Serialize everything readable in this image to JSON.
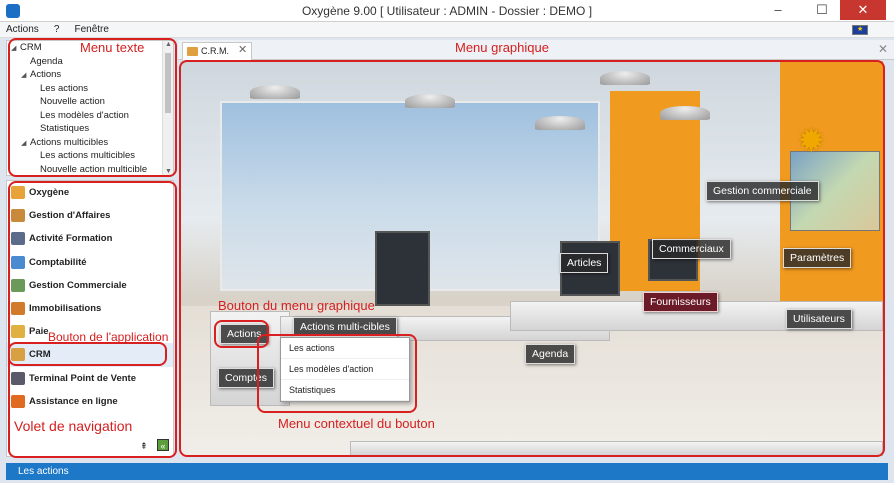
{
  "window": {
    "title": "Oxygène 9.00 [ Utilisateur : ADMIN - Dossier : DEMO ]",
    "minimize": "–",
    "maximize": "☐",
    "close": "✕"
  },
  "menubar": [
    "Actions",
    "?",
    "Fenêtre"
  ],
  "tree": {
    "items": [
      {
        "label": "CRM",
        "level": 0,
        "expander": "◢"
      },
      {
        "label": "Agenda",
        "level": 1,
        "expander": ""
      },
      {
        "label": "Actions",
        "level": 1,
        "expander": "◢"
      },
      {
        "label": "Les actions",
        "level": 2,
        "expander": ""
      },
      {
        "label": "Nouvelle action",
        "level": 2,
        "expander": ""
      },
      {
        "label": "Les modèles d'action",
        "level": 2,
        "expander": ""
      },
      {
        "label": "Statistiques",
        "level": 2,
        "expander": ""
      },
      {
        "label": "Actions multicibles",
        "level": 1,
        "expander": "◢"
      },
      {
        "label": "Les actions multicibles",
        "level": 2,
        "expander": ""
      },
      {
        "label": "Nouvelle action multicible",
        "level": 2,
        "expander": ""
      }
    ]
  },
  "nav": {
    "items": [
      {
        "label": "Oxygène",
        "color": "#e8a23a"
      },
      {
        "label": "Gestion d'Affaires",
        "color": "#c88a3a"
      },
      {
        "label": "Activité Formation",
        "color": "#5a6c8a"
      },
      {
        "label": "Comptabilité",
        "color": "#4a8ad0"
      },
      {
        "label": "Gestion Commerciale",
        "color": "#6a9a5a"
      },
      {
        "label": "Immobilisations",
        "color": "#d07a2a"
      },
      {
        "label": "Paie",
        "color": "#e0b040"
      },
      {
        "label": "CRM",
        "color": "#d8a040"
      },
      {
        "label": "Terminal Point de Vente",
        "color": "#5a5a6a"
      },
      {
        "label": "Assistance en ligne",
        "color": "#e06a20"
      }
    ],
    "active_index": 7,
    "pin_icon": "⇞",
    "collapse_icon": "«"
  },
  "tab": {
    "label": "C.R.M.",
    "close": "✕"
  },
  "pane_close": "✕",
  "scene_buttons": {
    "gestion_commerciale": "Gestion commerciale",
    "commerciaux": "Commerciaux",
    "articles": "Articles",
    "parametres": "Paramètres",
    "fournisseurs": "Fournisseurs",
    "utilisateurs": "Utilisateurs",
    "actions": "Actions",
    "actions_multi": "Actions multi-cibles",
    "agenda": "Agenda",
    "comptes": "Comptes"
  },
  "context_menu": [
    "Les actions",
    "Les modèles d'action",
    "Statistiques"
  ],
  "annotations": {
    "menu_texte": "Menu texte",
    "menu_graphique": "Menu graphique",
    "bouton_menu_graphique": "Bouton du menu graphique",
    "bouton_application": "Bouton de l'application",
    "menu_contextuel": "Menu contextuel du bouton",
    "volet_navigation": "Volet de navigation"
  },
  "status": {
    "text": "Les actions"
  }
}
